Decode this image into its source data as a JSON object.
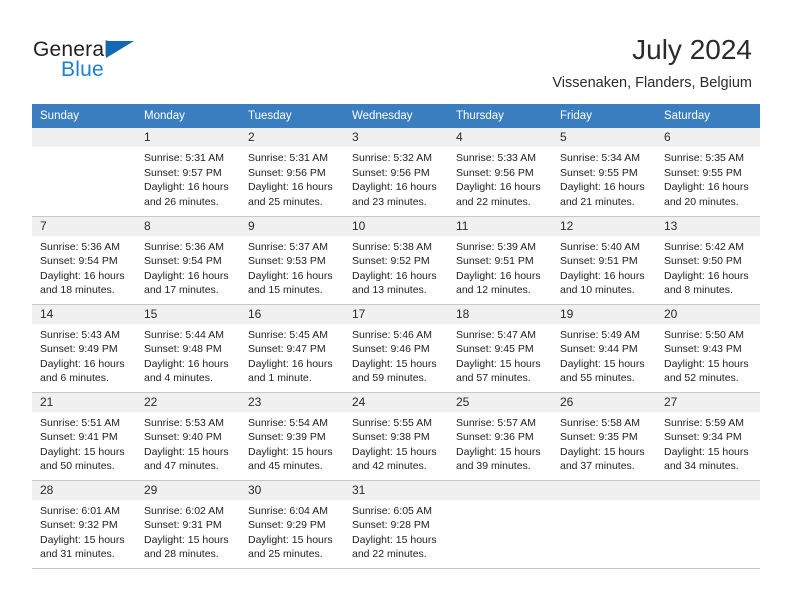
{
  "logo": {
    "word_one": "General",
    "word_two": "Blue",
    "triangle_color": "#1268b3",
    "blue_text_color": "#1f7fd0"
  },
  "header": {
    "title": "July 2024",
    "location": "Vissenaken, Flanders, Belgium"
  },
  "theme": {
    "header_bg": "#3a7ebf",
    "header_text": "#ffffff",
    "daynum_bg": "#f0f0f0",
    "grid_line": "#c8c8c8"
  },
  "columns": [
    "Sunday",
    "Monday",
    "Tuesday",
    "Wednesday",
    "Thursday",
    "Friday",
    "Saturday"
  ],
  "weeks": [
    [
      {
        "day": "",
        "sunrise": "",
        "sunset": "",
        "daylight1": "",
        "daylight2": ""
      },
      {
        "day": "1",
        "sunrise": "Sunrise: 5:31 AM",
        "sunset": "Sunset: 9:57 PM",
        "daylight1": "Daylight: 16 hours",
        "daylight2": "and 26 minutes."
      },
      {
        "day": "2",
        "sunrise": "Sunrise: 5:31 AM",
        "sunset": "Sunset: 9:56 PM",
        "daylight1": "Daylight: 16 hours",
        "daylight2": "and 25 minutes."
      },
      {
        "day": "3",
        "sunrise": "Sunrise: 5:32 AM",
        "sunset": "Sunset: 9:56 PM",
        "daylight1": "Daylight: 16 hours",
        "daylight2": "and 23 minutes."
      },
      {
        "day": "4",
        "sunrise": "Sunrise: 5:33 AM",
        "sunset": "Sunset: 9:56 PM",
        "daylight1": "Daylight: 16 hours",
        "daylight2": "and 22 minutes."
      },
      {
        "day": "5",
        "sunrise": "Sunrise: 5:34 AM",
        "sunset": "Sunset: 9:55 PM",
        "daylight1": "Daylight: 16 hours",
        "daylight2": "and 21 minutes."
      },
      {
        "day": "6",
        "sunrise": "Sunrise: 5:35 AM",
        "sunset": "Sunset: 9:55 PM",
        "daylight1": "Daylight: 16 hours",
        "daylight2": "and 20 minutes."
      }
    ],
    [
      {
        "day": "7",
        "sunrise": "Sunrise: 5:36 AM",
        "sunset": "Sunset: 9:54 PM",
        "daylight1": "Daylight: 16 hours",
        "daylight2": "and 18 minutes."
      },
      {
        "day": "8",
        "sunrise": "Sunrise: 5:36 AM",
        "sunset": "Sunset: 9:54 PM",
        "daylight1": "Daylight: 16 hours",
        "daylight2": "and 17 minutes."
      },
      {
        "day": "9",
        "sunrise": "Sunrise: 5:37 AM",
        "sunset": "Sunset: 9:53 PM",
        "daylight1": "Daylight: 16 hours",
        "daylight2": "and 15 minutes."
      },
      {
        "day": "10",
        "sunrise": "Sunrise: 5:38 AM",
        "sunset": "Sunset: 9:52 PM",
        "daylight1": "Daylight: 16 hours",
        "daylight2": "and 13 minutes."
      },
      {
        "day": "11",
        "sunrise": "Sunrise: 5:39 AM",
        "sunset": "Sunset: 9:51 PM",
        "daylight1": "Daylight: 16 hours",
        "daylight2": "and 12 minutes."
      },
      {
        "day": "12",
        "sunrise": "Sunrise: 5:40 AM",
        "sunset": "Sunset: 9:51 PM",
        "daylight1": "Daylight: 16 hours",
        "daylight2": "and 10 minutes."
      },
      {
        "day": "13",
        "sunrise": "Sunrise: 5:42 AM",
        "sunset": "Sunset: 9:50 PM",
        "daylight1": "Daylight: 16 hours",
        "daylight2": "and 8 minutes."
      }
    ],
    [
      {
        "day": "14",
        "sunrise": "Sunrise: 5:43 AM",
        "sunset": "Sunset: 9:49 PM",
        "daylight1": "Daylight: 16 hours",
        "daylight2": "and 6 minutes."
      },
      {
        "day": "15",
        "sunrise": "Sunrise: 5:44 AM",
        "sunset": "Sunset: 9:48 PM",
        "daylight1": "Daylight: 16 hours",
        "daylight2": "and 4 minutes."
      },
      {
        "day": "16",
        "sunrise": "Sunrise: 5:45 AM",
        "sunset": "Sunset: 9:47 PM",
        "daylight1": "Daylight: 16 hours",
        "daylight2": "and 1 minute."
      },
      {
        "day": "17",
        "sunrise": "Sunrise: 5:46 AM",
        "sunset": "Sunset: 9:46 PM",
        "daylight1": "Daylight: 15 hours",
        "daylight2": "and 59 minutes."
      },
      {
        "day": "18",
        "sunrise": "Sunrise: 5:47 AM",
        "sunset": "Sunset: 9:45 PM",
        "daylight1": "Daylight: 15 hours",
        "daylight2": "and 57 minutes."
      },
      {
        "day": "19",
        "sunrise": "Sunrise: 5:49 AM",
        "sunset": "Sunset: 9:44 PM",
        "daylight1": "Daylight: 15 hours",
        "daylight2": "and 55 minutes."
      },
      {
        "day": "20",
        "sunrise": "Sunrise: 5:50 AM",
        "sunset": "Sunset: 9:43 PM",
        "daylight1": "Daylight: 15 hours",
        "daylight2": "and 52 minutes."
      }
    ],
    [
      {
        "day": "21",
        "sunrise": "Sunrise: 5:51 AM",
        "sunset": "Sunset: 9:41 PM",
        "daylight1": "Daylight: 15 hours",
        "daylight2": "and 50 minutes."
      },
      {
        "day": "22",
        "sunrise": "Sunrise: 5:53 AM",
        "sunset": "Sunset: 9:40 PM",
        "daylight1": "Daylight: 15 hours",
        "daylight2": "and 47 minutes."
      },
      {
        "day": "23",
        "sunrise": "Sunrise: 5:54 AM",
        "sunset": "Sunset: 9:39 PM",
        "daylight1": "Daylight: 15 hours",
        "daylight2": "and 45 minutes."
      },
      {
        "day": "24",
        "sunrise": "Sunrise: 5:55 AM",
        "sunset": "Sunset: 9:38 PM",
        "daylight1": "Daylight: 15 hours",
        "daylight2": "and 42 minutes."
      },
      {
        "day": "25",
        "sunrise": "Sunrise: 5:57 AM",
        "sunset": "Sunset: 9:36 PM",
        "daylight1": "Daylight: 15 hours",
        "daylight2": "and 39 minutes."
      },
      {
        "day": "26",
        "sunrise": "Sunrise: 5:58 AM",
        "sunset": "Sunset: 9:35 PM",
        "daylight1": "Daylight: 15 hours",
        "daylight2": "and 37 minutes."
      },
      {
        "day": "27",
        "sunrise": "Sunrise: 5:59 AM",
        "sunset": "Sunset: 9:34 PM",
        "daylight1": "Daylight: 15 hours",
        "daylight2": "and 34 minutes."
      }
    ],
    [
      {
        "day": "28",
        "sunrise": "Sunrise: 6:01 AM",
        "sunset": "Sunset: 9:32 PM",
        "daylight1": "Daylight: 15 hours",
        "daylight2": "and 31 minutes."
      },
      {
        "day": "29",
        "sunrise": "Sunrise: 6:02 AM",
        "sunset": "Sunset: 9:31 PM",
        "daylight1": "Daylight: 15 hours",
        "daylight2": "and 28 minutes."
      },
      {
        "day": "30",
        "sunrise": "Sunrise: 6:04 AM",
        "sunset": "Sunset: 9:29 PM",
        "daylight1": "Daylight: 15 hours",
        "daylight2": "and 25 minutes."
      },
      {
        "day": "31",
        "sunrise": "Sunrise: 6:05 AM",
        "sunset": "Sunset: 9:28 PM",
        "daylight1": "Daylight: 15 hours",
        "daylight2": "and 22 minutes."
      },
      {
        "day": "",
        "sunrise": "",
        "sunset": "",
        "daylight1": "",
        "daylight2": ""
      },
      {
        "day": "",
        "sunrise": "",
        "sunset": "",
        "daylight1": "",
        "daylight2": ""
      },
      {
        "day": "",
        "sunrise": "",
        "sunset": "",
        "daylight1": "",
        "daylight2": ""
      }
    ]
  ]
}
